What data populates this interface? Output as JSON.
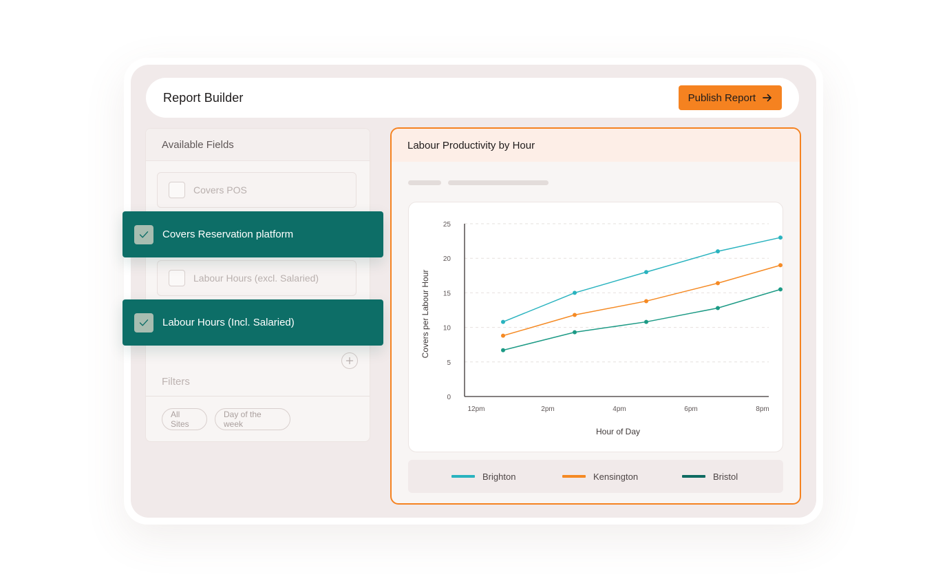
{
  "header": {
    "title": "Report Builder",
    "publish_label": "Publish Report"
  },
  "fields": {
    "heading": "Available Fields",
    "items": [
      {
        "label": "Covers POS",
        "checked": false
      },
      {
        "label": "Covers Reservation platform",
        "checked": true
      },
      {
        "label": "Labour Hours (excl. Salaried)",
        "checked": false
      },
      {
        "label": "Labour Hours (Incl. Salaried)",
        "checked": true
      }
    ]
  },
  "filters": {
    "heading": "Filters",
    "chips": [
      "All Sites",
      "Day of the week"
    ]
  },
  "chart_panel": {
    "title": "Labour Productivity by Hour"
  },
  "colors": {
    "accent": "#f58220",
    "selected": "#0d6e67",
    "brighton": "#2ab3bf",
    "kensington": "#f58a24",
    "bristol": "#1c9a85"
  },
  "chart_data": {
    "type": "line",
    "title": "",
    "xlabel": "Hour of Day",
    "ylabel": "Covers per Labour Hour",
    "x_ticks": [
      "12pm",
      "2pm",
      "4pm",
      "6pm",
      "8pm"
    ],
    "y_ticks": [
      0,
      5,
      10,
      15,
      20,
      25
    ],
    "xlim": [
      12,
      20
    ],
    "ylim": [
      0,
      25
    ],
    "grid": true,
    "legend": "bottom",
    "x": [
      12.75,
      14.75,
      16.75,
      18.75,
      20.5
    ],
    "series": [
      {
        "name": "Brighton",
        "values": [
          10.8,
          15,
          18,
          21,
          23
        ]
      },
      {
        "name": "Kensington",
        "values": [
          8.8,
          11.8,
          13.8,
          16.4,
          19
        ]
      },
      {
        "name": "Bristol",
        "values": [
          6.7,
          9.3,
          10.8,
          12.8,
          15.5
        ]
      }
    ]
  }
}
